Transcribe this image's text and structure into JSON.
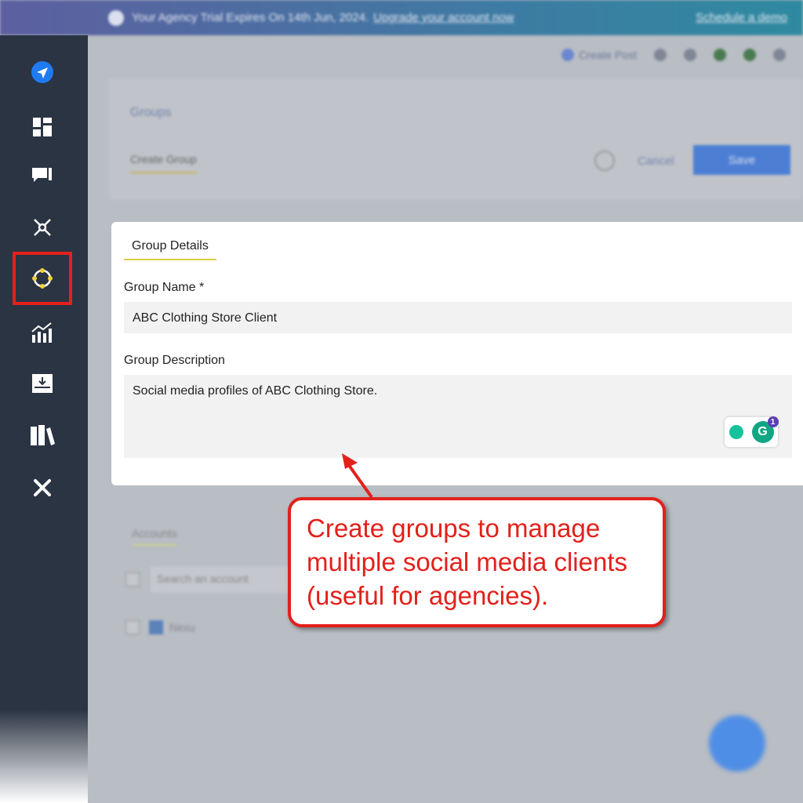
{
  "banner": {
    "text": "Your Agency Trial Expires On 14th Jun, 2024.",
    "link": "Upgrade your account now",
    "demo": "Schedule a demo"
  },
  "topbar": {
    "create_post": "Create Post"
  },
  "header": {
    "back": "Groups",
    "tab": "Create Group",
    "cancel": "Cancel",
    "save": "Save"
  },
  "sidebar": {
    "items": [
      "send-icon",
      "dashboard-icon",
      "compose-icon",
      "network-icon",
      "groups-icon",
      "analytics-icon",
      "inbox-icon",
      "library-icon",
      "tools-icon"
    ],
    "active": "groups-icon",
    "highlight_color": "#e3201b"
  },
  "form": {
    "tab": "Group Details",
    "name_label": "Group Name *",
    "name_value": "ABC Clothing Store Client",
    "desc_label": "Group Description",
    "desc_value": "Social media profiles of ABC Clothing Store.",
    "grammarly_count": "1"
  },
  "accounts": {
    "tab": "Accounts",
    "search_placeholder": "Search an account",
    "item": "Nexu"
  },
  "callout": {
    "lines": [
      "Create groups to manage",
      "multiple social media clients",
      "(useful for agencies)."
    ],
    "color": "#e3201b"
  }
}
